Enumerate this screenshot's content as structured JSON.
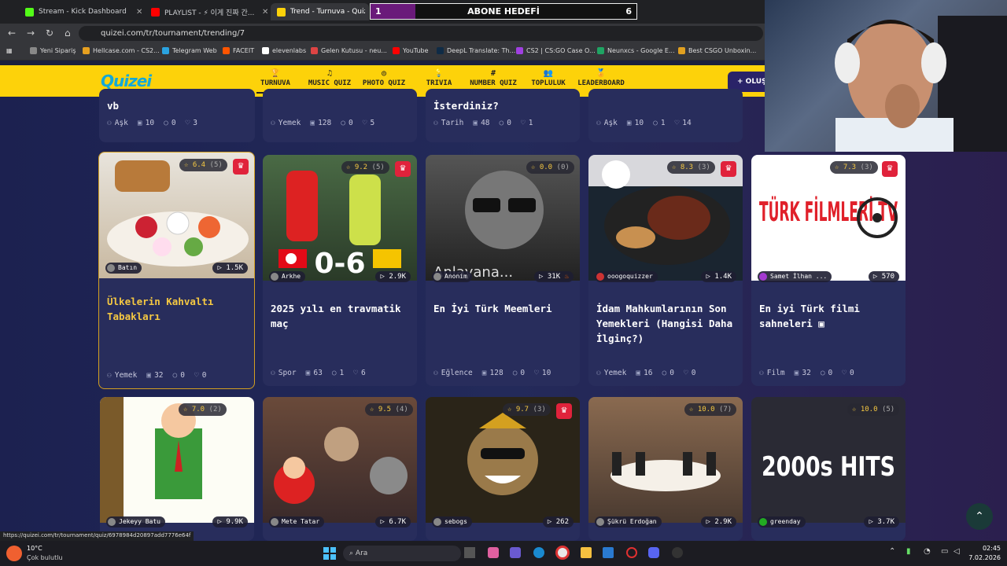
{
  "browser": {
    "tabs": [
      {
        "title": "Stream - Kick Dashboard",
        "color": "#53fc18"
      },
      {
        "title": "PLAYLIST - ⚡ 이게 진짜 간...",
        "color": "#ff0000"
      },
      {
        "title": "Trend - Turnuva - Quizei",
        "color": "#fdd20a"
      }
    ],
    "url": "quizei.com/tr/tournament/trending/7",
    "bookmarks": [
      "Yeni Sipariş",
      "Hellcase.com - CS2...",
      "Telegram Web",
      "FACEIT",
      "elevenlabs",
      "Gelen Kutusu - neu...",
      "YouTube",
      "DeepL Translate: Th...",
      "CS2 | CS:GO Case O...",
      "Neunxcs - Google E...",
      "Best CSGO Unboxin..."
    ],
    "status_url": "https://quizei.com/tr/tournament/quiz/6978984d20897add7776e64f"
  },
  "overlay": {
    "abone_left": "1",
    "abone_label": "ABONE HEDEFİ",
    "abone_right": "6",
    "abone_progress": 0.17
  },
  "site": {
    "logo": "Quizei",
    "nav": [
      {
        "icon": "trophy-icon",
        "label": "TURNUVA",
        "glyph": "🏆"
      },
      {
        "icon": "music-icon",
        "label": "MUSIC QUIZ",
        "glyph": "♫"
      },
      {
        "icon": "camera-icon",
        "label": "PHOTO QUIZ",
        "glyph": "◎"
      },
      {
        "icon": "trivia-icon",
        "label": "TRIVIA",
        "glyph": "💡"
      },
      {
        "icon": "number-icon",
        "label": "NUMBER QUIZ",
        "glyph": "#"
      },
      {
        "icon": "community-icon",
        "label": "TOPLULUK",
        "glyph": "👥"
      },
      {
        "icon": "leaderboard-icon",
        "label": "LEADERBOARD",
        "glyph": "🏅"
      }
    ],
    "login_label": "+ OLUŞ"
  },
  "top_row": [
    {
      "title_tail": "vb",
      "category": "Aşk",
      "items": "10",
      "comments": "0",
      "likes": "3"
    },
    {
      "title_tail": "",
      "category": "Yemek",
      "items": "128",
      "comments": "0",
      "likes": "5"
    },
    {
      "title_tail": "İsterdiniz?",
      "category": "Tarih",
      "items": "48",
      "comments": "0",
      "likes": "1"
    },
    {
      "title_tail": "",
      "category": "Aşk",
      "items": "10",
      "comments": "1",
      "likes": "14"
    }
  ],
  "cards": [
    {
      "rating": "6.4",
      "count": "(5)",
      "crown": true,
      "author": "Batın",
      "plays": "1.5K",
      "title": "Ülkelerin Kahvaltı Tabakları",
      "category": "Yemek",
      "items": "32",
      "comments": "0",
      "likes": "0",
      "gold": true,
      "bg": "#e8e4dc"
    },
    {
      "rating": "9.2",
      "count": "(5)",
      "crown": true,
      "author": "Arkhe",
      "plays": "2.9K",
      "title": "2025 yılı en travmatik maç",
      "category": "Spor",
      "items": "63",
      "comments": "1",
      "likes": "6",
      "bg": "#3a5a35",
      "overlay_text": "0-6"
    },
    {
      "rating": "0.0",
      "count": "(0)",
      "crown": false,
      "author": "Anonim",
      "plays": "31K",
      "title": "En İyi Türk Meemleri",
      "category": "Eğlence",
      "items": "128",
      "comments": "0",
      "likes": "10",
      "bg": "#3a3a3a",
      "overlay_text": "Anlayana..."
    },
    {
      "rating": "8.3",
      "count": "(3)",
      "crown": true,
      "author": "ooogoquizzer",
      "plays": "1.4K",
      "title": "İdam Mahkumlarının Son Yemekleri (Hangisi Daha İlginç?)",
      "category": "Yemek",
      "items": "16",
      "comments": "0",
      "likes": "0",
      "bg": "#2a2a30"
    },
    {
      "rating": "7.3",
      "count": "(3)",
      "crown": true,
      "author": "Samet İlhan ...",
      "plays": "570",
      "title": "En iyi Türk filmi sahneleri",
      "category": "Film",
      "items": "32",
      "comments": "0",
      "likes": "0",
      "bg": "#ffffff",
      "overlay_text": "TÜRK FİLMLERİ TV"
    }
  ],
  "bottom_row": [
    {
      "rating": "7.0",
      "count": "(2)",
      "crown": true,
      "author": "Jekeyy Batu",
      "plays": "9.9K",
      "bg": "#5a8a3a"
    },
    {
      "rating": "9.5",
      "count": "(4)",
      "crown": false,
      "author": "Mete Tatar",
      "plays": "6.7K",
      "bg": "#6a4a3a"
    },
    {
      "rating": "9.7",
      "count": "(3)",
      "crown": true,
      "author": "sebogs",
      "plays": "262",
      "bg": "#2a2418"
    },
    {
      "rating": "10.0",
      "count": "(7)",
      "crown": false,
      "author": "Şükrü Erdoğan",
      "plays": "2.9K",
      "bg": "#6a5040"
    },
    {
      "rating": "10.0",
      "count": "(5)",
      "crown": false,
      "author": "greenday",
      "plays": "3.7K",
      "bg": "#2a2a34",
      "overlay_text": "2000s HITS"
    }
  ],
  "taskbar": {
    "weather_temp": "10°C",
    "weather_desc": "Çok bulutlu",
    "search": "Ara",
    "time": "02:45",
    "date": "7.02.2026"
  }
}
